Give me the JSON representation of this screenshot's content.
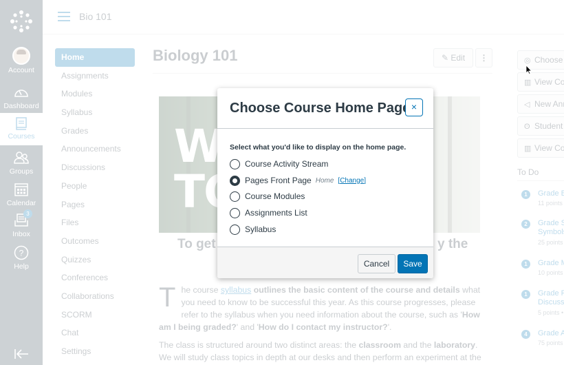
{
  "global_nav": {
    "items": [
      {
        "label": "Account",
        "icon": "avatar"
      },
      {
        "label": "Dashboard",
        "icon": "dashboard-icon"
      },
      {
        "label": "Courses",
        "icon": "courses-icon",
        "active": true
      },
      {
        "label": "Groups",
        "icon": "groups-icon"
      },
      {
        "label": "Calendar",
        "icon": "calendar-icon"
      },
      {
        "label": "Inbox",
        "icon": "inbox-icon",
        "badge": "3"
      },
      {
        "label": "Help",
        "icon": "help-icon"
      }
    ],
    "collapse_icon": "collapse-nav-icon"
  },
  "header": {
    "breadcrumb": "Bio 101"
  },
  "course_nav": {
    "items": [
      "Home",
      "Assignments",
      "Modules",
      "Syllabus",
      "Grades",
      "Announcements",
      "Discussions",
      "People",
      "Pages",
      "Files",
      "Outcomes",
      "Quizzes",
      "Conferences",
      "Collaborations",
      "SCORM",
      "Chat",
      "Settings"
    ],
    "active": "Home"
  },
  "main": {
    "title": "Biology 101",
    "edit_label": "Edit",
    "more_label": "⋮",
    "hero_text_line1": "WE",
    "hero_text_line2": "TO",
    "hero_caption_left": "To get",
    "hero_caption_right": "y the",
    "body": {
      "dropcap": "T",
      "p1_a": "he course ",
      "p1_link": "syllabus",
      "p1_b": " outlines the basic content of the course and details",
      "p1_c": " what you need to know to be successful this year. As this course progresses, please refer to the syllabus when you need information about the course, such as '",
      "p1_d": "How am I being graded?",
      "p1_e": "' and '",
      "p1_f": "How do I contact my instructor?",
      "p1_g": "'.",
      "p2_a": "The class is structured around two distinct areas: the ",
      "p2_b": "classroom",
      "p2_c": " and the ",
      "p2_d": "laboratory",
      "p2_e": ". We will study class topics in depth at our desks and then perform an experiment at the"
    }
  },
  "right_sidebar": {
    "buttons": [
      {
        "label": "Choose Home Page",
        "icon": "target-icon"
      },
      {
        "label": "View Course Stream",
        "icon": "chart-icon"
      },
      {
        "label": "New Announcement",
        "icon": "megaphone-icon"
      },
      {
        "label": "Student View",
        "icon": "glasses-icon"
      },
      {
        "label": "View Course Analytics",
        "icon": "chart-icon"
      }
    ],
    "todo_title": "To Do",
    "todo": [
      {
        "count": "1",
        "name": "Grade Bi",
        "meta": "11 points"
      },
      {
        "count": "2",
        "name": "Grade Sa",
        "name2": "Symbols",
        "meta": "25 points"
      },
      {
        "count": "1",
        "name": "Grade M",
        "meta": "10 points"
      },
      {
        "count": "1",
        "name": "Grade Pr",
        "name2": "Discussio",
        "meta": "5 points •"
      },
      {
        "count": "4",
        "name": "Grade Ar",
        "meta": "75 points"
      }
    ]
  },
  "modal": {
    "title": "Choose Course Home Page",
    "close_label": "×",
    "prompt": "Select what you'd like to display on the home page.",
    "options": [
      {
        "label": "Course Activity Stream",
        "checked": false
      },
      {
        "label": "Pages Front Page",
        "checked": true,
        "sub": "Home",
        "change": "Change"
      },
      {
        "label": "Course Modules",
        "checked": false
      },
      {
        "label": "Assignments List",
        "checked": false
      },
      {
        "label": "Syllabus",
        "checked": false
      }
    ],
    "cancel_label": "Cancel",
    "save_label": "Save"
  }
}
